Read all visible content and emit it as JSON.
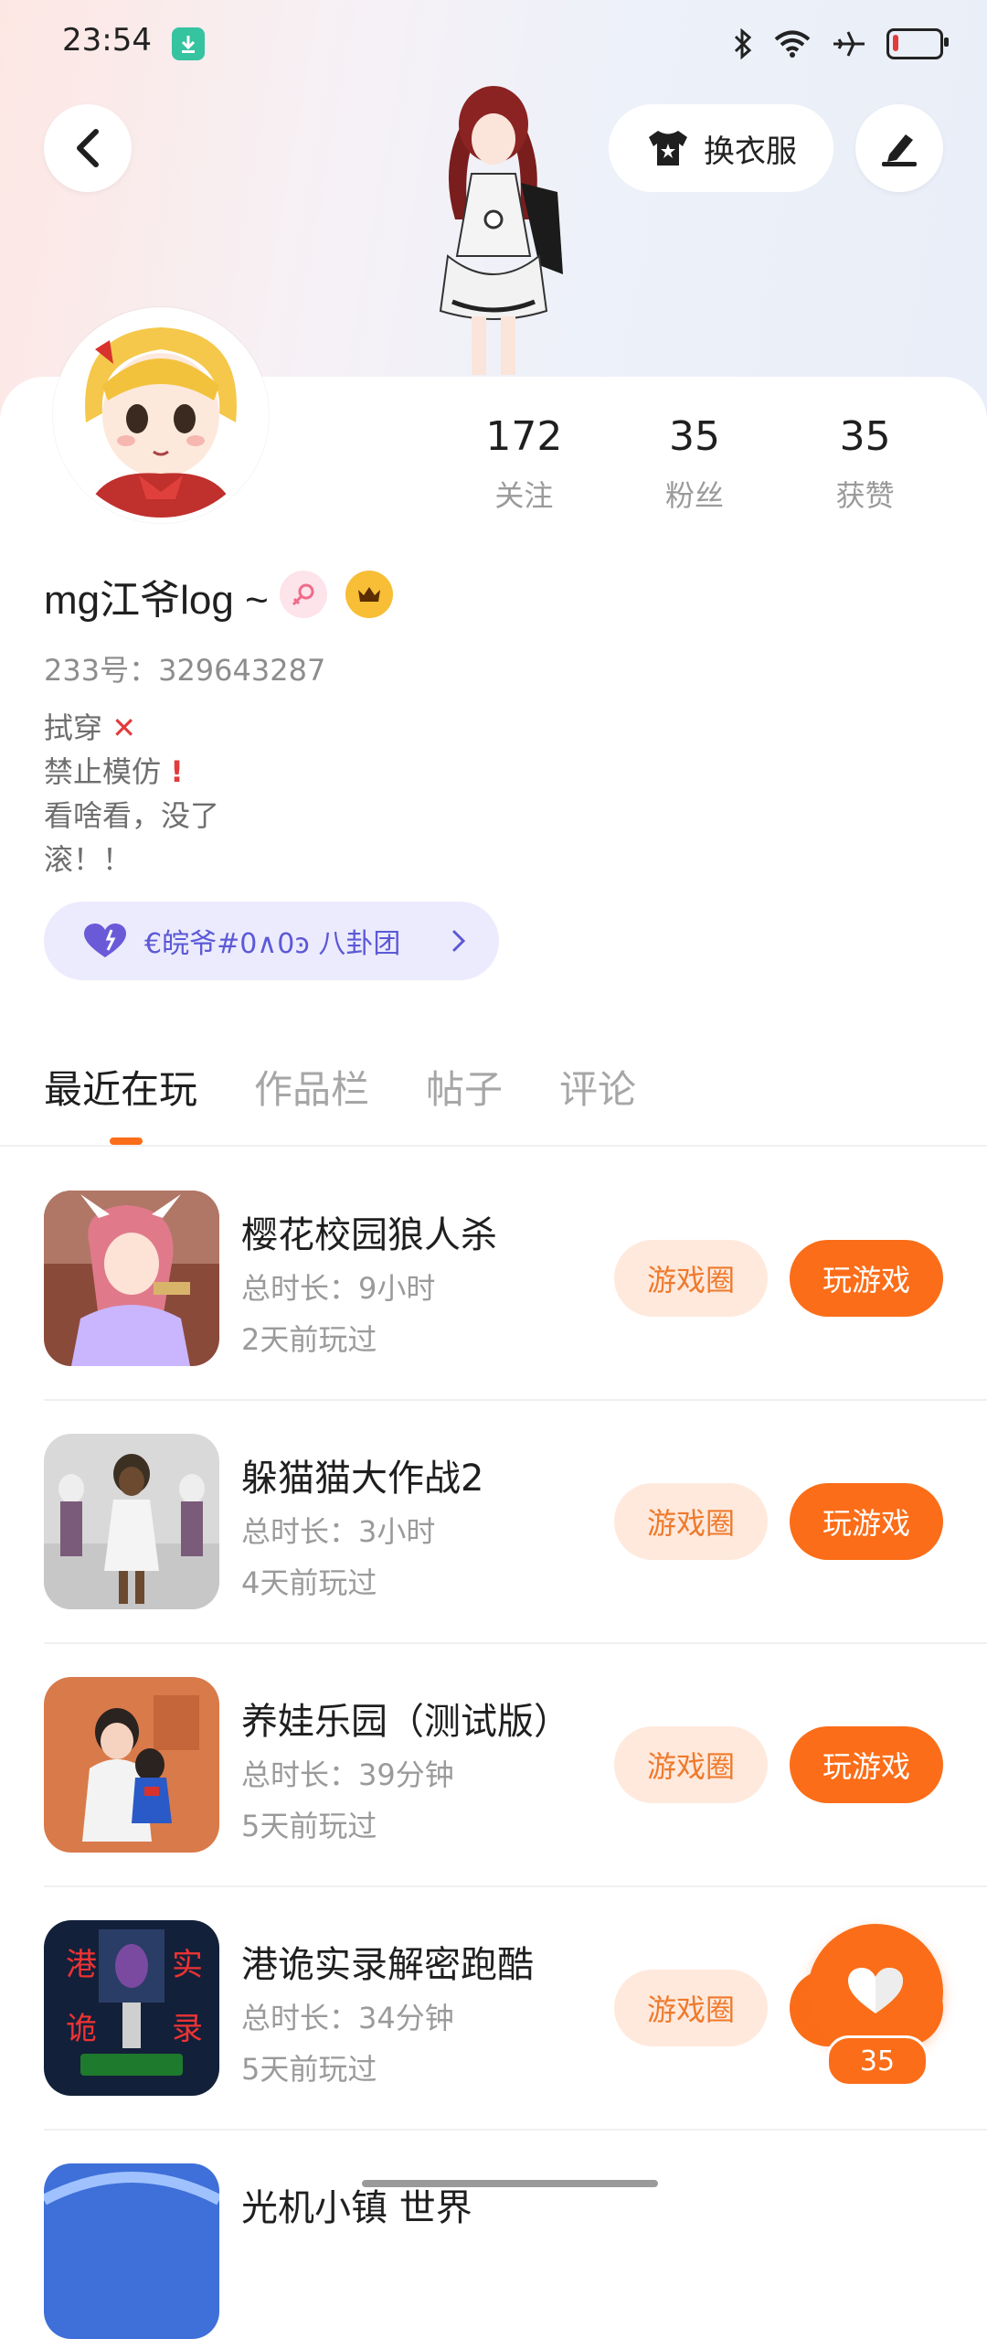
{
  "status_bar": {
    "time": "23:54"
  },
  "header": {
    "dress_label": "换衣服"
  },
  "stats": [
    {
      "value": "172",
      "label": "关注"
    },
    {
      "value": "35",
      "label": "粉丝"
    },
    {
      "value": "35",
      "label": "获赞"
    }
  ],
  "profile": {
    "username": "mg江爷log ~",
    "uid": "233号：329643287",
    "bio": [
      "拭穿",
      "禁止模仿",
      "看啥看，没了",
      "滚！！"
    ]
  },
  "group": {
    "label": "€皖爷#0∧0ͽ 八卦团"
  },
  "tabs": [
    "最近在玩",
    "作品栏",
    "帖子",
    "评论"
  ],
  "buttons": {
    "circle": "游戏圈",
    "play": "玩游戏"
  },
  "games": [
    {
      "name": "樱花校园狼人杀",
      "duration": "总时长：9小时",
      "last_played": "2天前玩过"
    },
    {
      "name": "躲猫猫大作战2",
      "duration": "总时长：3小时",
      "last_played": "4天前玩过"
    },
    {
      "name": "养娃乐园（测试版）",
      "duration": "总时长：39分钟",
      "last_played": "5天前玩过"
    },
    {
      "name": "港诡实录解密跑酷",
      "duration": "总时长：34分钟",
      "last_played": "5天前玩过"
    },
    {
      "name": "光机小镇 世界"
    }
  ],
  "like": {
    "count": "35"
  },
  "colors": {
    "accent": "#fb6d18",
    "accent_light": "#ffe9dd",
    "group_bg": "#ecebfd",
    "group_text": "#5b59d6"
  },
  "battery_level": 0.12
}
